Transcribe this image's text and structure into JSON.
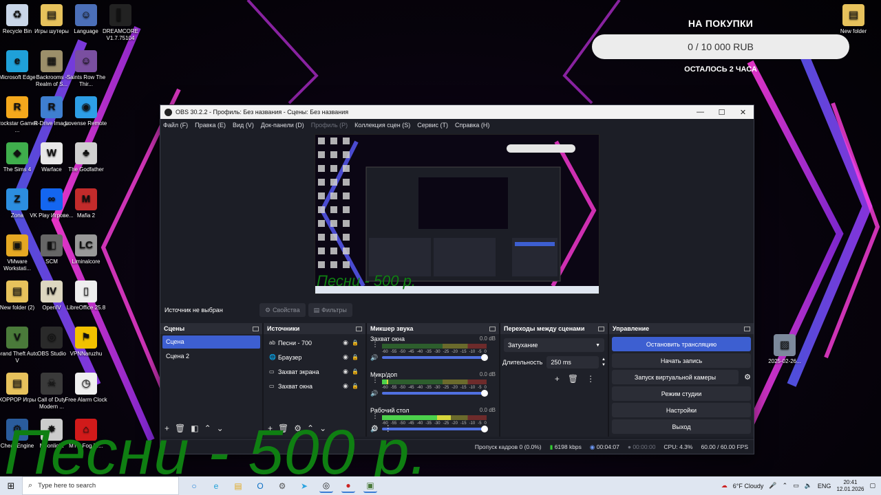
{
  "desktop": {
    "icons": [
      {
        "label": "Recycle Bin",
        "icon": "recycle-bin-icon",
        "color": "#c9d6e8",
        "glyph": "♻"
      },
      {
        "label": "Игры шутеры",
        "icon": "folder-icon",
        "color": "#e7c25c",
        "glyph": "▤"
      },
      {
        "label": "Language",
        "icon": "anime-app-icon",
        "color": "#4b6fb8",
        "glyph": "☺"
      },
      {
        "label": "DREAMCORE V1.7.75104",
        "icon": "dreamcore-icon",
        "color": "#222222",
        "glyph": "▌"
      },
      {
        "label": "Microsoft Edge",
        "icon": "edge-icon",
        "color": "#1fa1d9",
        "glyph": "e"
      },
      {
        "label": "Backrooms - Realm of S...",
        "icon": "backrooms-icon",
        "color": "#9c8f6a",
        "glyph": "▦"
      },
      {
        "label": "Saints Row The Thir...",
        "icon": "saints-row-icon",
        "color": "#7a4fa0",
        "glyph": "☺"
      },
      {
        "label": "Rockstar Games ...",
        "icon": "rockstar-icon",
        "color": "#f4a81c",
        "glyph": "R"
      },
      {
        "label": "R-Drive Image",
        "icon": "rdrive-icon",
        "color": "#3f7fd0",
        "glyph": "R"
      },
      {
        "label": "Lovense Remote",
        "icon": "lovense-icon",
        "color": "#2d9ee6",
        "glyph": "◉"
      },
      {
        "label": "The Sims 4",
        "icon": "sims-icon",
        "color": "#3fae4c",
        "glyph": "◆"
      },
      {
        "label": "Warface",
        "icon": "warface-icon",
        "color": "#e8e8e8",
        "glyph": "W"
      },
      {
        "label": "The Godfather",
        "icon": "godfather-icon",
        "color": "#d0d0d0",
        "glyph": "♣"
      },
      {
        "label": "Zona",
        "icon": "zona-icon",
        "color": "#2c8ee0",
        "glyph": "Z"
      },
      {
        "label": "VK Play Игрове...",
        "icon": "vkplay-icon",
        "color": "#1466f0",
        "glyph": "∞"
      },
      {
        "label": "Mafia 2",
        "icon": "mafia-icon",
        "color": "#c22b2b",
        "glyph": "M"
      },
      {
        "label": "VMware Workstati...",
        "icon": "vmware-icon",
        "color": "#e5a823",
        "glyph": "▣"
      },
      {
        "label": "SCM",
        "icon": "scm-icon",
        "color": "#666666",
        "glyph": "◧"
      },
      {
        "label": "Liminalcore",
        "icon": "liminalcore-icon",
        "color": "#999999",
        "glyph": "LC"
      },
      {
        "label": "New folder (2)",
        "icon": "folder-icon",
        "color": "#e7c25c",
        "glyph": "▤"
      },
      {
        "label": "OpenIV",
        "icon": "openiv-icon",
        "color": "#ddd7c0",
        "glyph": "IV"
      },
      {
        "label": "LibreOffice 25.8",
        "icon": "libreoffice-icon",
        "color": "#eeeeee",
        "glyph": "▯"
      },
      {
        "label": "Grand Theft Auto V",
        "icon": "gta-icon",
        "color": "#4a7a3a",
        "glyph": "V"
      },
      {
        "label": "OBS Studio",
        "icon": "obs-icon",
        "color": "#2a2a2a",
        "glyph": "◎"
      },
      {
        "label": "VPNNaruzhu",
        "icon": "vpn-icon",
        "color": "#f2c100",
        "glyph": "⚑"
      },
      {
        "label": "ХОРРОР Игры",
        "icon": "folder-icon",
        "color": "#e7c25c",
        "glyph": "▤"
      },
      {
        "label": "Call of Duty Modern ...",
        "icon": "cod-icon",
        "color": "#3a3a3a",
        "glyph": "☠"
      },
      {
        "label": "Free Alarm Clock",
        "icon": "alarm-clock-icon",
        "color": "#f0f0f0",
        "glyph": "◷"
      },
      {
        "label": "Cheat Engine",
        "icon": "cheat-engine-icon",
        "color": "#2a5c9c",
        "glyph": "⚙"
      },
      {
        "label": "Moonlight",
        "icon": "moonlight-icon",
        "color": "#cccccc",
        "glyph": "✸"
      },
      {
        "label": "MTC Fog PI...",
        "icon": "mtc-icon",
        "color": "#d11a1a",
        "glyph": "⌂"
      }
    ],
    "right_icons": [
      {
        "label": "New folder",
        "icon": "folder-icon",
        "color": "#e7c25c",
        "glyph": "▤"
      },
      {
        "label": "2025-02-26...",
        "icon": "image-file-icon",
        "color": "#7d8a9c",
        "glyph": "▨"
      }
    ]
  },
  "donation": {
    "title": "НА ПОКУПКИ",
    "progress_text": "0 / 10 000 RUB",
    "progress_fraction": 0,
    "subtitle": "ОСТАЛОСЬ 2 ЧАСА"
  },
  "obs": {
    "window_title": "OBS 30.2.2 - Профиль: Без названия - Сцены: Без названия",
    "menu": [
      {
        "label": "Файл (F)",
        "enabled": true
      },
      {
        "label": "Правка (E)",
        "enabled": true
      },
      {
        "label": "Вид (V)",
        "enabled": true
      },
      {
        "label": "Док-панели (D)",
        "enabled": true
      },
      {
        "label": "Профиль (P)",
        "enabled": false
      },
      {
        "label": "Коллекция сцен (S)",
        "enabled": true
      },
      {
        "label": "Сервис (T)",
        "enabled": true
      },
      {
        "label": "Справка (H)",
        "enabled": true
      }
    ],
    "source_bar": {
      "no_source": "Источник не выбран",
      "properties": "Свойства",
      "filters": "Фильтры"
    },
    "scenes": {
      "title": "Сцены",
      "items": [
        "Сцена",
        "Сцена 2"
      ],
      "selected": 0
    },
    "sources": {
      "title": "Источники",
      "items": [
        {
          "name": "Песни - 700",
          "icon": "text-icon",
          "glyph": "ab"
        },
        {
          "name": "Браузер",
          "icon": "globe-icon",
          "glyph": "🌐"
        },
        {
          "name": "Захват экрана",
          "icon": "monitor-icon",
          "glyph": "▭"
        },
        {
          "name": "Захват окна",
          "icon": "window-icon",
          "glyph": "▭"
        }
      ]
    },
    "mixer": {
      "title": "Микшер звука",
      "scale": [
        "-60",
        "-55",
        "-50",
        "-45",
        "-40",
        "-35",
        "-30",
        "-25",
        "-20",
        "-15",
        "-10",
        "-5",
        "0"
      ],
      "channels": [
        {
          "name": "Захват окна",
          "db": "0.0 dB",
          "level": 0.0
        },
        {
          "name": "Микр/доп",
          "db": "0.0 dB",
          "level": 0.06
        },
        {
          "name": "Рабочий стол",
          "db": "0.0 dB",
          "level": 0.66
        }
      ]
    },
    "transitions": {
      "title": "Переходы между сценами",
      "selected": "Затухание",
      "duration_label": "Длительность",
      "duration_value": "250 ms"
    },
    "controls": {
      "title": "Управление",
      "stop_stream": "Остановить трансляцию",
      "start_record": "Начать запись",
      "virtual_cam": "Запуск виртуальной камеры",
      "studio_mode": "Режим студии",
      "settings": "Настройки",
      "exit": "Выход"
    },
    "status": {
      "dropped": "Пропуск кадров 0 (0.0%)",
      "bitrate": "6198 kbps",
      "stream_time": "00:04:07",
      "record_time": "00:00:00",
      "cpu": "CPU: 4.3%",
      "fps": "60.00 / 60.00 FPS"
    },
    "preview_overlay": "Песни - 500 р."
  },
  "overlay_text": "Песни - 500 р.",
  "taskbar": {
    "search_placeholder": "Type here to search",
    "weather": "6°F  Cloudy",
    "lang": "ENG",
    "time": "20:41",
    "date": "12.01.2026"
  },
  "colors": {
    "accent": "#3d5fd1",
    "overlay_green": "#0f7f12",
    "wallpaper_pink": "#e040d0",
    "wallpaper_blue": "#4050ff"
  }
}
